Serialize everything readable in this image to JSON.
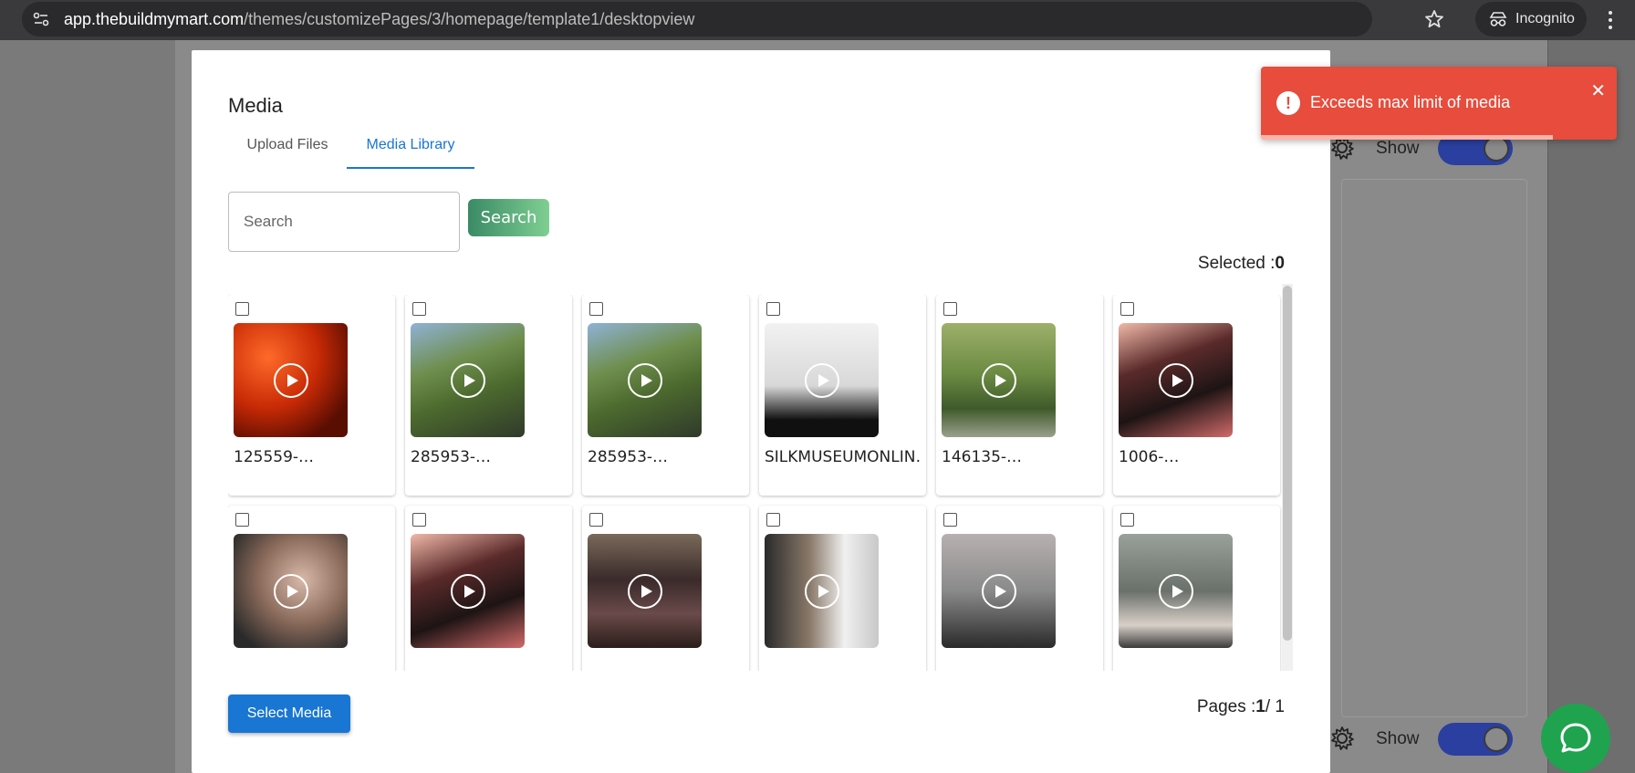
{
  "browser": {
    "url_host": "app.thebuildmymart.com",
    "url_path": "/themes/customizePages/3/homepage/template1/desktopview",
    "incognito_label": "Incognito"
  },
  "background": {
    "show_label_1": "Show",
    "show_label_2": "Show"
  },
  "modal": {
    "title": "Media",
    "tabs": [
      {
        "label": "Upload Files",
        "active": false
      },
      {
        "label": "Media Library",
        "active": true
      }
    ],
    "search": {
      "placeholder": "Search",
      "button_label": "Search"
    },
    "selected": {
      "label": "Selected :",
      "count": "0"
    },
    "items": [
      {
        "name": "125559-…",
        "bg": "radial-gradient(circle at 30% 30%, #ff6a2a, #c72a05 45%, #5a0e02 80%)"
      },
      {
        "name": "285953-…",
        "bg": "linear-gradient(160deg, #8fb2d6 0%, #6f8f4f 35%, #4d6b2e 60%, #2f3a2a 100%)"
      },
      {
        "name": "285953-…",
        "bg": "linear-gradient(160deg, #8fb2d6 0%, #6f8f4f 35%, #4d6b2e 60%, #2f3a2a 100%)"
      },
      {
        "name": "SILKMUSEUMONLIN…",
        "bg": "linear-gradient(180deg, #f2f2f2 0%, #d8d8d8 55%, #101010 85%)"
      },
      {
        "name": "146135-…",
        "bg": "linear-gradient(180deg, #9db06a 0%, #6b8a42 45%, #3f5a2a 75%, #9aa08c 100%)"
      },
      {
        "name": "1006-…",
        "bg": "linear-gradient(160deg, #f0b8a8 0%, #5a2a2a 35%, #1e1414 65%, #d06a6a 100%)"
      },
      {
        "name": "",
        "bg": "radial-gradient(circle at 60% 40%, #d8b8a8, #8a6a5a 45%, #2a2a2a 85%)"
      },
      {
        "name": "",
        "bg": "linear-gradient(160deg, #f0b8a8 0%, #5a2a2a 35%, #1e1414 65%, #d06a6a 100%)"
      },
      {
        "name": "",
        "bg": "linear-gradient(180deg, #7a6a5a 0%, #3a2a2a 40%, #6a4a4a 70%, #2a1e1a 100%)"
      },
      {
        "name": "",
        "bg": "linear-gradient(90deg, #2a2a2a 0%, #8a7a6a 40%, #f0f0f0 70%, #c8c8c8 100%)"
      },
      {
        "name": "",
        "bg": "linear-gradient(180deg, #b8b0b0 0%, #8a8a8a 50%, #2a2a2a 100%)"
      },
      {
        "name": "",
        "bg": "linear-gradient(180deg, #9aa09a 0%, #6a706a 50%, #d8d0c8 80%, #3a3a3a 100%)"
      }
    ],
    "select_button_label": "Select Media",
    "pages": {
      "label": "Pages :",
      "current": "1",
      "total": "/ 1"
    }
  },
  "toast": {
    "message": "Exceeds max limit of media",
    "color": "#e74c3c",
    "progress": 0.82
  },
  "chat": {
    "icon": "chat-bubble-icon",
    "color": "#1fa34f"
  }
}
